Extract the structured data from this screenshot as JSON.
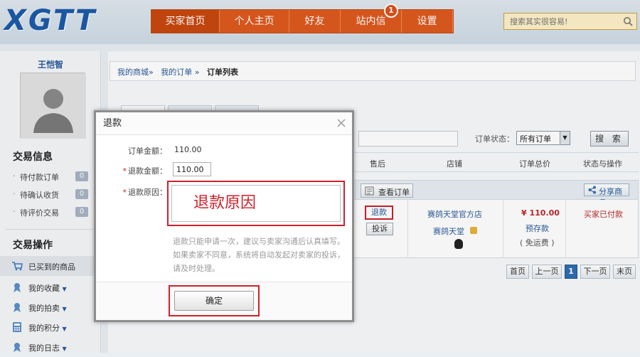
{
  "header": {
    "logo": "XGTT",
    "nav": [
      {
        "label": "买家首页",
        "active": true
      },
      {
        "label": "个人主页",
        "active": false
      },
      {
        "label": "好友",
        "active": false
      },
      {
        "label": "站内信",
        "active": false,
        "badge": "1"
      },
      {
        "label": "设置",
        "active": false
      }
    ],
    "search_placeholder": "搜索其实很容易!",
    "colors": {
      "nav_bg": "#de5a1f",
      "logo": "#1d5aa8"
    }
  },
  "sidebar": {
    "username": "王恺智",
    "trade_info_title": "交易信息",
    "trade_info_items": [
      {
        "label": "待付款订单",
        "count": "0"
      },
      {
        "label": "待确认收货",
        "count": "0"
      },
      {
        "label": "待评价交易",
        "count": "0"
      }
    ],
    "trade_ops_title": "交易操作",
    "trade_ops_items": [
      {
        "label": "已买到的商品",
        "icon": "cart-icon",
        "active": true
      },
      {
        "label": "我的收藏",
        "icon": "ribbon-icon",
        "active": false,
        "dropdown": true
      },
      {
        "label": "我的拍卖",
        "icon": "ribbon-icon",
        "active": false,
        "dropdown": true
      },
      {
        "label": "我的积分",
        "icon": "calculator-icon",
        "active": false,
        "dropdown": true
      },
      {
        "label": "我的日志",
        "icon": "ribbon-icon",
        "active": false,
        "dropdown": true
      }
    ]
  },
  "breadcrumb": {
    "items": [
      "我的商城»",
      "我的订单 »"
    ],
    "current": "订单列表"
  },
  "filters": {
    "status_label": "订单状态：",
    "status_value": "所有订单",
    "search_button": "搜 索"
  },
  "table": {
    "columns": [
      "售后",
      "店铺",
      "订单总价",
      "状态与操作"
    ],
    "view_order_label": "查看订单",
    "share_label": "分享商品",
    "row": {
      "refund_label": "退款",
      "complain_label": "投诉",
      "shop_name": "赛鸽天堂官方店",
      "seller_name": "赛鸽天堂",
      "price": "¥ 110.00",
      "price_note": "预存款",
      "shipping_note": "( 免运费 )",
      "status": "买家已付款"
    }
  },
  "pagination": {
    "first": "首页",
    "prev": "上一页",
    "current": "1",
    "next": "下一页",
    "last": "末页"
  },
  "dialog": {
    "title": "退款",
    "order_amount_label": "订单金额：",
    "order_amount_value": "110.00",
    "refund_amount_label": "退款金额：",
    "refund_amount_value": "110.00",
    "reason_label": "退款原因：",
    "reason_value": "退款原因",
    "hint": "退款只能申请一次，建议与卖家沟通后认真填写。如果卖家不同意，系统将自动发起对卖家的投诉，请及时处理。",
    "confirm_label": "确定",
    "highlight_color": "#d0202a"
  }
}
